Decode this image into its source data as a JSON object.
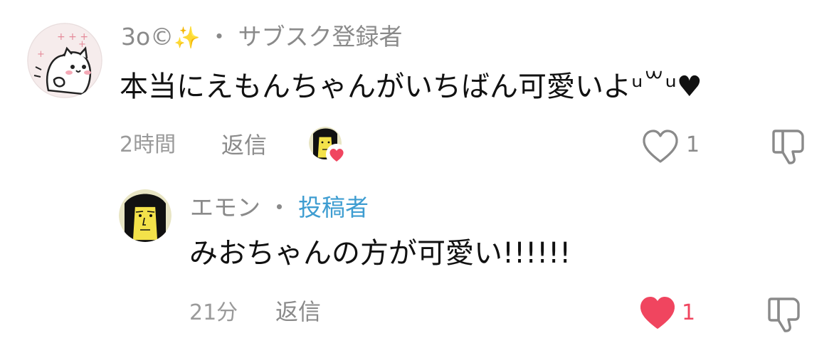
{
  "comments": [
    {
      "author": "3o©",
      "author_emoji": "✨",
      "separator": "・",
      "badge": "サブスク登録者",
      "text": "本当にえもんちゃんがいちばん可愛いよᵘ꒳ᵘ♥",
      "time": "2時間",
      "reply_label": "返信",
      "likes": "1",
      "liked": false,
      "creator_hearted": true
    },
    {
      "author": "エモン",
      "separator": "・",
      "badge": "投稿者",
      "text": "みおちゃんの方が可愛い!!!!!!",
      "time": "21分",
      "reply_label": "返信",
      "likes": "1",
      "liked": true
    }
  ],
  "colors": {
    "meta_gray": "#8a8a8a",
    "creator_blue": "#3e9dd1",
    "like_red": "#f0455f",
    "text": "#111111"
  },
  "icons": {
    "like_outline": "heart-outline-icon",
    "like_filled": "heart-filled-icon",
    "dislike": "thumbs-down-icon"
  }
}
